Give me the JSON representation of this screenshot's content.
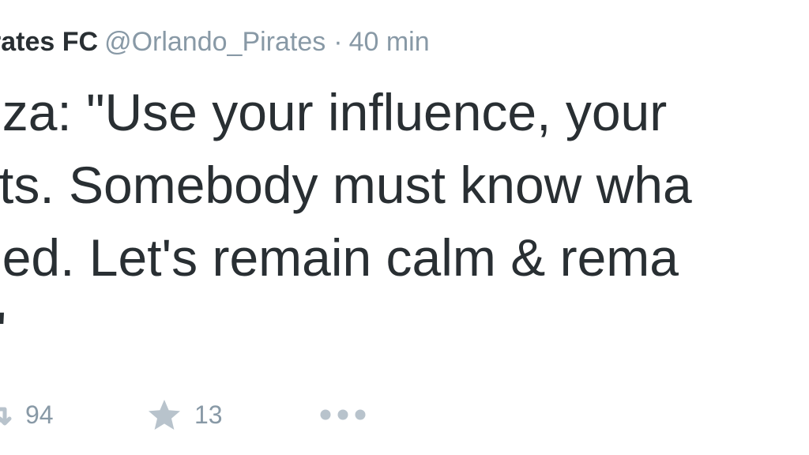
{
  "tweet": {
    "fullname": "rates FC",
    "username": "@Orlando_Pirates",
    "separator": "·",
    "time": "40 min",
    "text_lines": [
      "oza: \"Use your influence, your",
      "cts. Somebody must know wha",
      "ned. Let's remain calm & rema",
      "t\""
    ]
  },
  "actions": {
    "retweet_count": "94",
    "favorite_count": "13",
    "retweet_icon": "retweet-icon",
    "favorite_icon": "star-icon",
    "more_icon": "more-dots-icon"
  },
  "colors": {
    "text": "#292f33",
    "secondary": "#8899a6",
    "icon": "#b8c3cc",
    "background": "#ffffff"
  }
}
